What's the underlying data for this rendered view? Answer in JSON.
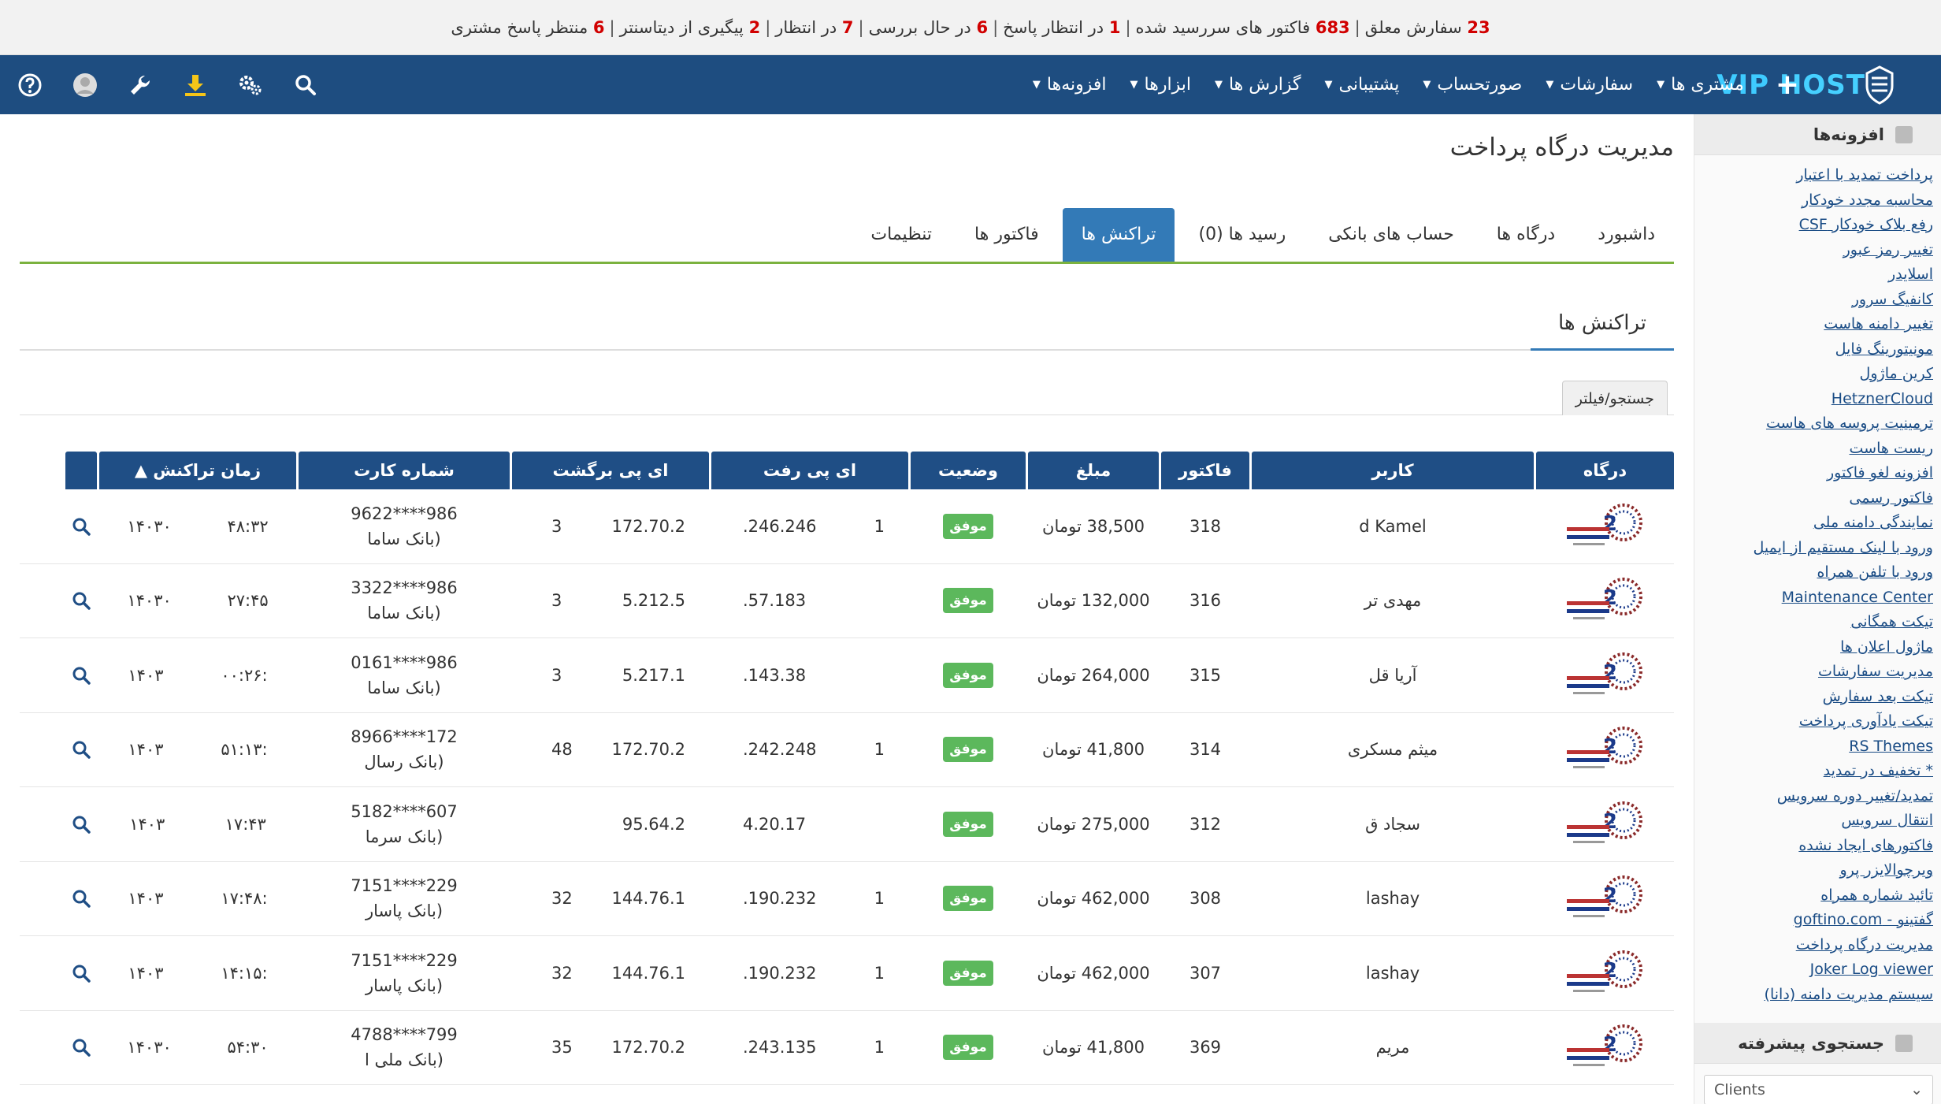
{
  "alerts": [
    {
      "count": "23",
      "label": "سفارش معلق"
    },
    {
      "count": "683",
      "label": "فاکتور های سررسید شده"
    },
    {
      "count": "1",
      "label": "در انتظار پاسخ"
    },
    {
      "count": "6",
      "label": "در حال بررسی"
    },
    {
      "count": "7",
      "label": "در انتظار"
    },
    {
      "count": "2",
      "label": "پیگیری از دیتاسنتر"
    },
    {
      "count": "6",
      "label": "منتظر پاسخ مشتری"
    }
  ],
  "brand": {
    "part1": "VIP",
    "part2": "HOST"
  },
  "nav": {
    "plus": "+",
    "items": [
      "مشتری ها",
      "سفارشات",
      "صورتحساب",
      "پشتیبانی",
      "گزارش ها",
      "ابزارها",
      "افزونه‌ها"
    ]
  },
  "nav_icons": [
    "search-icon",
    "gears-icon",
    "download-icon",
    "wrench-icon",
    "avatar-icon",
    "help-icon"
  ],
  "sidebar": {
    "addons_title": "افزونه‌ها",
    "links": [
      "پرداخت تمدید با اعتبار",
      "محاسبه مجدد خودکار",
      "رفع بلاک خودکار CSF",
      "تغییر رمز عبور",
      "اسلایدر",
      "کانفیگ سرور",
      "تغییر دامنه هاست",
      "مونیتورینگ فایل",
      "کرین ماژول",
      "HetznerCloud",
      "ترمینیت پروسه های هاست",
      "ریست هاست",
      "افزونه لغو فاکتور",
      "فاکتور رسمی",
      "نمایندگی دامنه ملی",
      "ورود با لینک مستقیم از ایمیل",
      "ورود با تلفن همراه",
      "Maintenance Center",
      "تیکت همگانی",
      "ماژول اعلان ها",
      "مدیریت سفارشات",
      "تیکت بعد سفارش",
      "تیکت یادآوری پرداخت",
      "RS Themes",
      "* تخفیف در تمدید",
      "تمدید/تغییر دوره سرویس",
      "انتقال سرویس",
      "فاکتورهای ایجاد نشده",
      "ویرچوالایزر پرو",
      "تائید شماره همراه",
      "گفتینو - goftino.com",
      "مدیریت درگاه پرداخت",
      "Joker Log viewer",
      "سیستم مدیریت دامنه (دانا)"
    ],
    "search_title": "جستجوی پیشرفته",
    "search_select": "Clients"
  },
  "main": {
    "title": "مدیریت درگاه پرداخت",
    "tabs": [
      "داشبورد",
      "درگاه ها",
      "حساب های بانکی",
      "رسید ها (0)",
      "تراکنش ها",
      "فاکتور ها",
      "تنظیمات"
    ],
    "active_tab": 4,
    "subtab": "تراکنش ها",
    "filter_label": "جستجو/فیلتر"
  },
  "table": {
    "headers": [
      "درگاه",
      "کاربر",
      "فاکتور",
      "مبلغ",
      "وضعیت",
      "ای پی رفت",
      "ای پی برگشت",
      "شماره کارت",
      "زمان تراکنش ▲",
      ""
    ],
    "rows": [
      {
        "user": "d Kamel",
        "invoice": "318",
        "amount": "38,500 تومان",
        "status": "موفق",
        "ip_out_a": ".246.246",
        "ip_out_b": "1",
        "ip_ret_a": "3",
        "ip_ret_b": "172.70.2",
        "card": "986****9622",
        "bank": "(بانک ساما",
        "time": "۴۸:۳۲",
        "date": "۱۴۰۳۰"
      },
      {
        "user": "مهدی تر",
        "invoice": "316",
        "amount": "132,000 تومان",
        "status": "موفق",
        "ip_out_a": ".57.183",
        "ip_out_b": "",
        "ip_ret_a": "3",
        "ip_ret_b": "5.212.5",
        "card": "986****3322",
        "bank": "(بانک ساما",
        "time": "۲۷:۴۵",
        "date": "۱۴۰۳۰"
      },
      {
        "user": "آریا قل",
        "invoice": "315",
        "amount": "264,000 تومان",
        "status": "موفق",
        "ip_out_a": ".143.38",
        "ip_out_b": "",
        "ip_ret_a": "3",
        "ip_ret_b": "5.217.1",
        "card": "986****0161",
        "bank": "(بانک ساما",
        "time": ":۰۰:۲۶",
        "date": "۱۴۰۳"
      },
      {
        "user": "میثم مسکری",
        "invoice": "314",
        "amount": "41,800 تومان",
        "status": "موفق",
        "ip_out_a": ".242.248",
        "ip_out_b": "1",
        "ip_ret_a": "48",
        "ip_ret_b": "172.70.2",
        "card": "172****8966",
        "bank": "(بانک رسال",
        "time": ":۵۱:۱۳",
        "date": "۱۴۰۳"
      },
      {
        "user": "سجاد ق",
        "invoice": "312",
        "amount": "275,000 تومان",
        "status": "موفق",
        "ip_out_a": "4.20.17",
        "ip_out_b": "",
        "ip_ret_a": "",
        "ip_ret_b": "95.64.2",
        "card": "607****5182",
        "bank": "(بانک سرما",
        "time": "۱۷:۴۳",
        "date": "۱۴۰۳"
      },
      {
        "user": "lashay",
        "invoice": "308",
        "amount": "462,000 تومان",
        "status": "موفق",
        "ip_out_a": ".190.232",
        "ip_out_b": "1",
        "ip_ret_a": "32",
        "ip_ret_b": "144.76.1",
        "card": "229****7151",
        "bank": "(بانک پاسار",
        "time": ":۱۷:۴۸",
        "date": "۱۴۰۳"
      },
      {
        "user": "lashay",
        "invoice": "307",
        "amount": "462,000 تومان",
        "status": "موفق",
        "ip_out_a": ".190.232",
        "ip_out_b": "1",
        "ip_ret_a": "32",
        "ip_ret_b": "144.76.1",
        "card": "229****7151",
        "bank": "(بانک پاسار",
        "time": ":۱۴:۱۵",
        "date": "۱۴۰۳"
      },
      {
        "user": "مریم",
        "invoice": "369",
        "amount": "41,800 تومان",
        "status": "موفق",
        "ip_out_a": ".243.135",
        "ip_out_b": "1",
        "ip_ret_a": "35",
        "ip_ret_b": "172.70.2",
        "card": "799****4788",
        "bank": "(بانک ملی ا",
        "time": "۵۴:۳۰",
        "date": "۱۴۰۳۰"
      }
    ]
  },
  "colors": {
    "navbar": "#1e4d80",
    "accent": "#337ab7",
    "success": "#5cb85c",
    "alert_count": "#d10000",
    "tab_line": "#7bb23e"
  }
}
